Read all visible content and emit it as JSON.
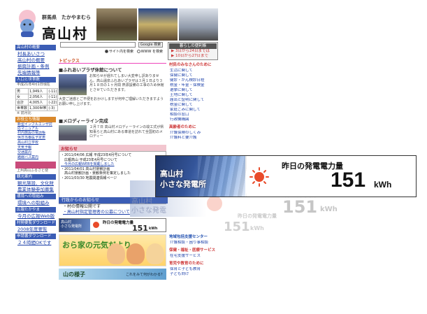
{
  "header": {
    "prefecture": "群馬県",
    "reading": "たかやまむら",
    "village_name": "高山村"
  },
  "left_sidebar": {
    "sec1": "高山村の概要",
    "sec1_links": [
      "村長あいさつ",
      "高山村の概要",
      "振興計画・条例",
      "先端情報等"
    ],
    "sec2": "人口と世帯数",
    "pop_date": "平成21年4月1日現在",
    "pop_rows": [
      {
        "label": "男",
        "value": "1,949人",
        "diff": "(-11)"
      },
      {
        "label": "女",
        "value": "2,056人",
        "diff": "(-11)"
      },
      {
        "label": "合計",
        "value": "4,005人",
        "diff": "(-22)"
      },
      {
        "label": "世帯数",
        "value": "1,300世帯",
        "diff": "(-3)"
      }
    ],
    "pop_note": "※ 前月比",
    "sec3": "お役立ち情報",
    "sec3_links": [
      "新型インフルエンザ対応マニュアル",
      "村内施設の電話帳",
      "休日当番医予定表",
      "高山村立学校",
      "天気予報",
      "交通案内",
      "路線バス案内"
    ],
    "sec4_caption": "上州高山ふるさと便",
    "sec5": "観光案内",
    "sec5_links": [
      "観光施設、文化財",
      "農業体験参加募集"
    ],
    "sec6": "環境への取組み",
    "sec6_links": [
      "環境への取組み"
    ],
    "sec7": "広報たかやま",
    "sec7_links": [
      "今月の広報Web版"
    ],
    "sec8": "村勢要覧ダウンロード",
    "sec8_links": [
      "2008年度要覧"
    ],
    "sec9": "申請書ダウンロード",
    "sec9_links": [
      "２４時間OKです"
    ]
  },
  "search": {
    "placeholder": "",
    "button": "Google 検索",
    "opt_site": "サイト内を検索",
    "opt_www": "WWW を検索"
  },
  "topics": {
    "heading": "トピックス",
    "item1_title": "■ふれあいプラザ休館について",
    "item1_text": "お知らせが遅れてしまい大変申し訳ありません。高山温泉ふれあいプラザは３月１日より３月１８日の１ヶ月間 熱源設備の工事のため休館とさせていただきます。",
    "item1_text2": "大変ご迷惑とご不便をおかけしますが何卒ご理解いただきますようお願い申し上げます。",
    "item2_title": "■メロディーライン完成",
    "item2_text": "２月７日 高山村メロディーラインの竣工式が県知事らと高山村にある車道を訪れて全国初のメロディー"
  },
  "notices": {
    "heading": "お知らせ",
    "items": [
      "・2011/04/06 広報 平成23年4月号について",
      "　広報高山 平成23年4月号について",
      "　今月の広報WEBを掲載しました",
      "・2011/04/01 高山村景観計画",
      "　高山村景観計画・景観条例を策定しました",
      "・2011/03/30 地震関連情報ページ"
    ]
  },
  "right_sidebar": {
    "box_heading": "暮らしの便利帳",
    "box_links": [
      "▶ 3日から24日までは",
      "▶ 10日から27日まで"
    ],
    "sec_a": "村民のみなさんのために",
    "sec_a_links": [
      "生活に関して",
      "保健に関して",
      "健診・がん検診日程",
      "税金・年金・保険金",
      "選挙に関して",
      "土地に関して",
      "届出と証明に関して",
      "税金に関して",
      "家庭ごみに関して",
      "相談の窓口",
      "行政機構図"
    ],
    "sec_b": "高齢者のために",
    "sec_b_links": [
      "介護保険のしくみ",
      "介護料と要介護"
    ],
    "sec_c": "地域包括支援センター",
    "sec_c_links": [
      "介護相談・困り事相談"
    ],
    "sec_d": "保健・福祉・医療サービス",
    "sec_d_links": [
      "在宅支援サービス"
    ],
    "sec_e": "育児や教育のために",
    "sec_e_links": [
      "保育と子ども教育",
      "子ども向け"
    ]
  },
  "bottom": {
    "heading": "行政からのお知らせ",
    "links": [
      "・村の情報公開です",
      "・高山村指定管理者の公募について"
    ],
    "mini_power": {
      "left": "高山村\n小さな発電所",
      "label": "昨日の発電電力量",
      "value": "151",
      "unit": "kWh"
    },
    "banner1_title": "おら家の元気だより",
    "banner2_title": "山の様子",
    "banner2_sub": "これをみて何がわかる？"
  },
  "ghost": {
    "title": "高山村\n小さな発電",
    "label1": "昨日の発電電力量",
    "value1": "151",
    "unit1": "kWh",
    "label2": "昨日の発電電力量",
    "value2": "151",
    "unit2": "kWh"
  },
  "power_widget": {
    "title_line1": "高山村",
    "title_line2": "小さな発電所",
    "label": "昨日の発電電力量",
    "value": "151",
    "unit": "kWh",
    "colors": {
      "sun": "#e94b2a",
      "panel_dark": "#1f3566",
      "panel_light": "#7fa6df"
    }
  }
}
